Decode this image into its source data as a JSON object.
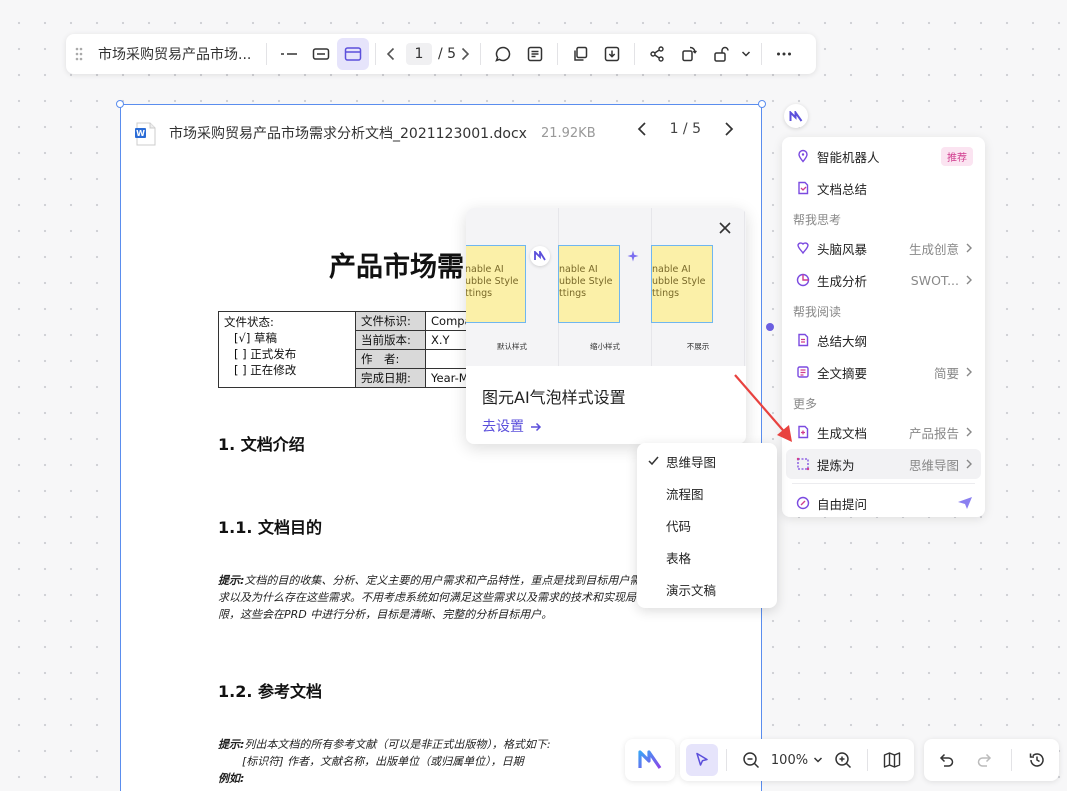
{
  "toolbar": {
    "title": "市场采购贸易产品市场...",
    "current_page": "1",
    "page_total": "/ 5"
  },
  "document": {
    "filename": "市场采购贸易产品市场需求分析文档_2021123001.docx",
    "filesize": "21.92KB",
    "page_indicator": "1 / 5",
    "title": "产品市场需",
    "status_label": "文件状态:",
    "status_options": [
      "[√] 草稿",
      "[ ] 正式发布",
      "[ ] 正在修改"
    ],
    "meta_rows": [
      {
        "key": "文件标识:",
        "value": "Compa"
      },
      {
        "key": "当前版本:",
        "value": "X.Y"
      },
      {
        "key": "作　者:",
        "value": ""
      },
      {
        "key": "完成日期:",
        "value": "Year-M"
      }
    ],
    "section1": "1. 文档介绍",
    "section1_1": "1.1. 文档目的",
    "hint1_label": "提示:",
    "hint1_text": "文档的目的收集、分析、定义主要的用户需求和产品特性，重点是找到目标用户需求以及为什么存在这些需求。不用考虑系统如何满足这些需求以及需求的技术和实现局限，这些会在PRD 中进行分析，目标是清晰、完整的分析目标用户。",
    "section1_2": "1.2. 参考文档",
    "hint2_label": "提示:",
    "hint2_text": "列出本文档的所有参考文献（可以是非正式出版物），格式如下:",
    "hint2_line2": "[标识符] 作者，文献名称，出版单位（或归属单位），日期",
    "hint2_line3": "例如:"
  },
  "bubble_popup": {
    "options": [
      {
        "label": "默认样式",
        "sticky_text": "nable AI\nubble Style\nttings"
      },
      {
        "label": "缩小样式",
        "sticky_text": "nable AI\nubble Style\nttings"
      },
      {
        "label": "不展示",
        "sticky_text": "nable AI\nubble Style\nttings"
      }
    ],
    "title": "图元AI气泡样式设置",
    "link": "去设置"
  },
  "ai_menu": {
    "items_top": [
      {
        "label": "智能机器人",
        "badge": "推荐"
      },
      {
        "label": "文档总结"
      }
    ],
    "section_think": "帮我思考",
    "items_think": [
      {
        "label": "头脑风暴",
        "sub": "生成创意"
      },
      {
        "label": "生成分析",
        "sub": "SWOT..."
      }
    ],
    "section_read": "帮我阅读",
    "items_read": [
      {
        "label": "总结大纲"
      },
      {
        "label": "全文摘要",
        "sub": "简要"
      }
    ],
    "section_more": "更多",
    "items_more": [
      {
        "label": "生成文档",
        "sub": "产品报告"
      },
      {
        "label": "提炼为",
        "sub": "思维导图"
      }
    ],
    "free_ask": "自由提问"
  },
  "submenu": {
    "items": [
      "思维导图",
      "流程图",
      "代码",
      "表格",
      "演示文稿"
    ],
    "selected": "思维导图"
  },
  "bottom": {
    "zoom": "100%"
  },
  "colors": {
    "accent": "#5b4fdb",
    "selection": "#5a8dee",
    "arrow": "#e8423f",
    "sticky": "#fbf0a8"
  }
}
